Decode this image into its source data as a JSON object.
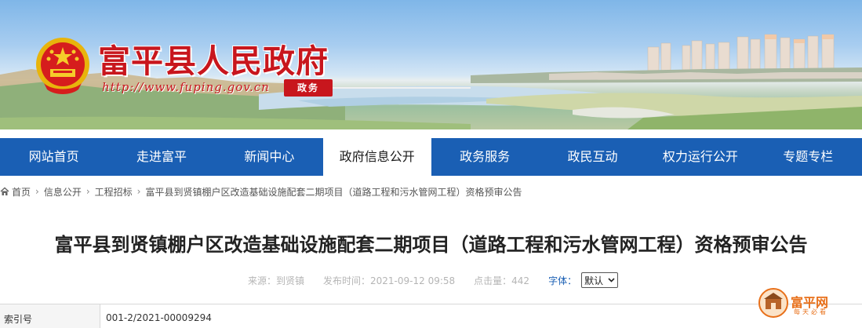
{
  "header": {
    "site_title": "富平县人民政府",
    "site_url": "http://www.fuping.gov.cn",
    "badge": "政务"
  },
  "nav": {
    "items": [
      {
        "label": "网站首页",
        "active": false
      },
      {
        "label": "走进富平",
        "active": false
      },
      {
        "label": "新闻中心",
        "active": false
      },
      {
        "label": "政府信息公开",
        "active": true
      },
      {
        "label": "政务服务",
        "active": false
      },
      {
        "label": "政民互动",
        "active": false
      },
      {
        "label": "权力运行公开",
        "active": false
      },
      {
        "label": "专题专栏",
        "active": false
      }
    ]
  },
  "breadcrumb": {
    "items": [
      "首页",
      "信息公开",
      "工程招标",
      "富平县到贤镇棚户区改造基础设施配套二期项目（道路工程和污水管网工程）资格预审公告"
    ]
  },
  "article": {
    "title": "富平县到贤镇棚户区改造基础设施配套二期项目（道路工程和污水管网工程）资格预审公告",
    "source": "来源：到贤镇",
    "publish_time": "发布时间：2021-09-12 09:58",
    "hits": "点击量：442",
    "font_label": "字体：",
    "font_value": "默认"
  },
  "info_table": {
    "label": "索引号",
    "value": "001-2/2021-00009294"
  },
  "watermark": {
    "name": "富平网",
    "tagline": "每天必看"
  },
  "colors": {
    "nav_bg": "#1a5fb4",
    "title_red": "#c8161d",
    "watermark_orange": "#e8701a"
  },
  "icons": {
    "home": "home-icon",
    "breadcrumb_sep": "chevron-right-icon",
    "select": "chevron-down-icon"
  }
}
